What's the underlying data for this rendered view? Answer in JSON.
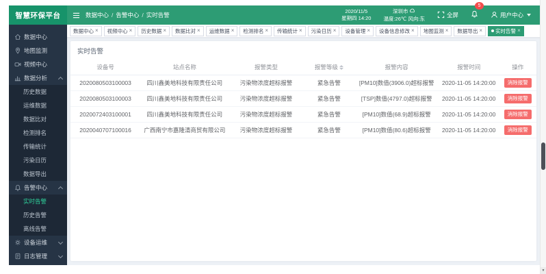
{
  "app": {
    "title": "智慧环保平台"
  },
  "header": {
    "breadcrumb": [
      "数据中心",
      "告警中心",
      "实时告警"
    ],
    "datetime_line1": "2020/11/5",
    "datetime_line2": "星期四 14:20",
    "weather_city": "深圳市",
    "weather_line2": "温度:26℃ 风向:东",
    "fullscreen_label": "全屏",
    "notification_count": "5",
    "user_label": "用户中心"
  },
  "tabs": [
    {
      "label": "数据中心",
      "active": false
    },
    {
      "label": "视频中心",
      "active": false
    },
    {
      "label": "历史数据",
      "active": false
    },
    {
      "label": "数据比对",
      "active": false
    },
    {
      "label": "运维数据",
      "active": false
    },
    {
      "label": "检测排名",
      "active": false
    },
    {
      "label": "传输统计",
      "active": false
    },
    {
      "label": "污染日历",
      "active": false
    },
    {
      "label": "设备管理",
      "active": false
    },
    {
      "label": "设备信息修改",
      "active": false
    },
    {
      "label": "地图监测",
      "active": false
    },
    {
      "label": "数据导出",
      "active": false
    },
    {
      "label": "实时告警",
      "active": true
    }
  ],
  "sidebar": {
    "items": [
      {
        "icon": "home-icon",
        "label": "数据中心"
      },
      {
        "icon": "map-pin-icon",
        "label": "地图监测"
      },
      {
        "icon": "video-camera-icon",
        "label": "视频中心"
      },
      {
        "icon": "bar-chart-icon",
        "label": "数据分析",
        "expanded": true,
        "children": [
          {
            "label": "历史数据"
          },
          {
            "label": "运维数据"
          },
          {
            "label": "数据比对"
          },
          {
            "label": "检测排名"
          },
          {
            "label": "传输统计"
          },
          {
            "label": "污染日历"
          },
          {
            "label": "数据导出"
          }
        ]
      },
      {
        "icon": "bell-icon",
        "label": "告警中心",
        "expanded": true,
        "children": [
          {
            "label": "实时告警",
            "active": true
          },
          {
            "label": "历史告警"
          },
          {
            "label": "离线告警"
          }
        ]
      },
      {
        "icon": "gear-icon",
        "label": "设备运维",
        "expanded": false,
        "children": []
      },
      {
        "icon": "document-icon",
        "label": "日志管理",
        "expanded": false,
        "children": []
      }
    ]
  },
  "panel": {
    "title": "实时告警"
  },
  "table": {
    "columns": [
      "设备号",
      "站点名称",
      "报警类型",
      "报警等级",
      "报警内容",
      "报警时间",
      "操作"
    ],
    "sortable_column": "报警等级",
    "rows": [
      {
        "device_no": "2020080503100003",
        "site": "四川鑫美地科技有限责任公司",
        "type": "污染物浓度超标报警",
        "level": "紧急告警",
        "content": "[PM10]数值(3906.0)超标报警",
        "time": "2020-11-05 14:20:00",
        "action": "消除报警"
      },
      {
        "device_no": "2020080503100003",
        "site": "四川鑫美地科技有限责任公司",
        "type": "污染物浓度超标报警",
        "level": "紧急告警",
        "content": "[TSP]数值(4797.0)超标报警",
        "time": "2020-11-05 14:20:00",
        "action": "消除报警"
      },
      {
        "device_no": "2020072403100001",
        "site": "四川鑫美地科技有限责任公司",
        "type": "污染物浓度超标报警",
        "level": "紧急告警",
        "content": "[PM10]数值(68.9)超标报警",
        "time": "2020-11-05 14:20:00",
        "action": "消除报警"
      },
      {
        "device_no": "2020040707100016",
        "site": "广西南宁市嘉隆清商贸有限公司",
        "type": "污染物浓度超标报警",
        "level": "紧急告警",
        "content": "[PM10]数值(80.6)超标报警",
        "time": "2020-11-05 14:20:00",
        "action": "消除报警"
      }
    ]
  },
  "colors": {
    "primary_green": "#2d9c74",
    "logo_green": "#17936a",
    "sidebar_bg": "#263445",
    "active_menu_green": "#2fd19b",
    "danger_red": "#f56c6c",
    "badge_red": "#f34d4d"
  }
}
